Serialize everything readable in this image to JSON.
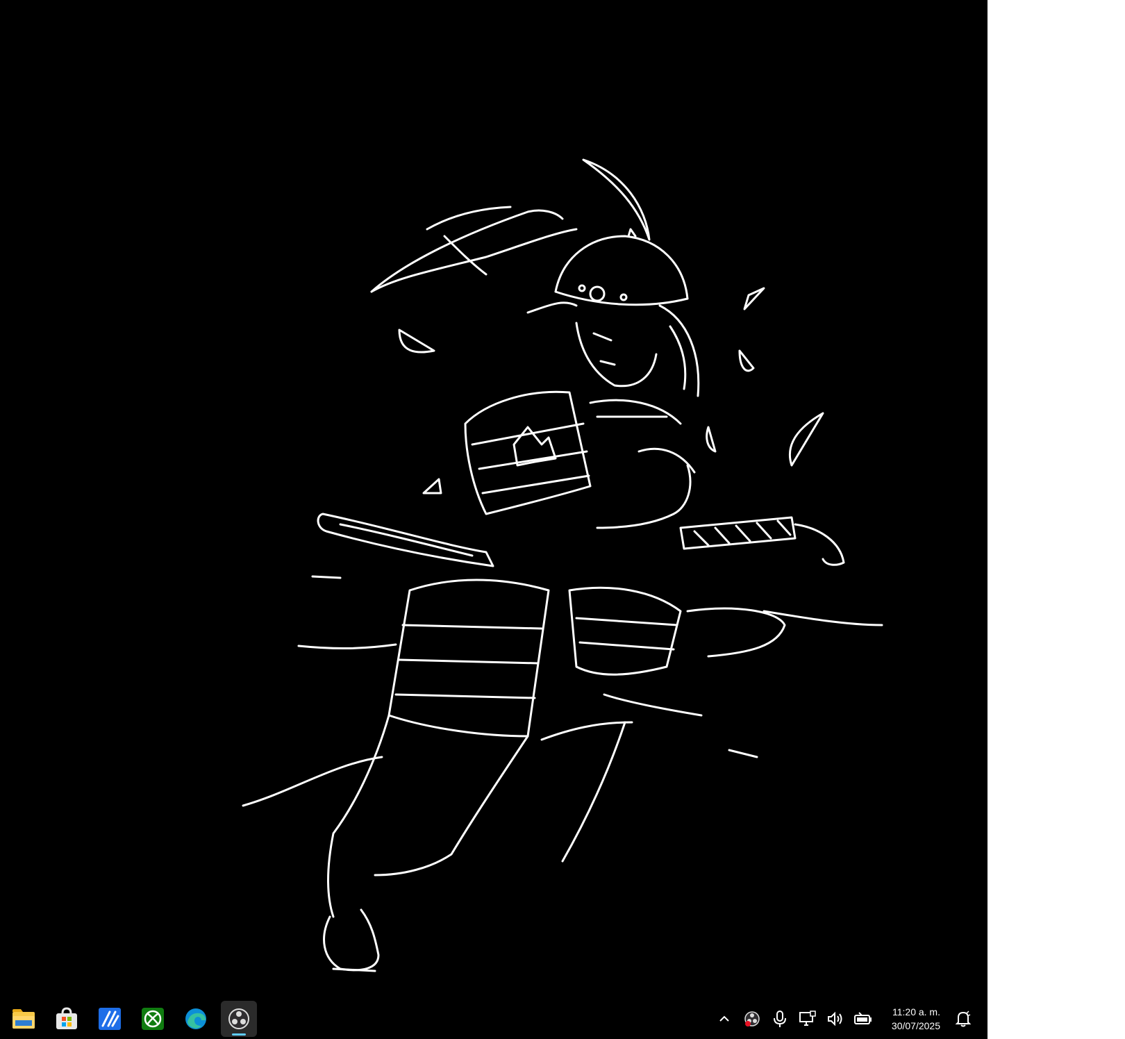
{
  "desktop": {
    "background_color": "#000000",
    "wallpaper_icon": "samurai-line-art-icon"
  },
  "taskbar": {
    "background_color": "#000000",
    "accent_color": "#60cdff",
    "pinned_apps": [
      {
        "name": "file-explorer-icon",
        "active": false
      },
      {
        "name": "microsoft-store-icon",
        "active": false
      },
      {
        "name": "app-blue-icon",
        "active": false
      },
      {
        "name": "xbox-icon",
        "active": false
      },
      {
        "name": "edge-icon",
        "active": false
      },
      {
        "name": "obs-icon",
        "active": true
      }
    ],
    "tray_icons": [
      "chevron-up-icon",
      "obs-tray-icon",
      "microphone-icon",
      "network-icon",
      "volume-icon",
      "battery-icon"
    ],
    "clock": {
      "time": "11:20 a. m.",
      "date": "30/07/2025"
    },
    "notification_icon": "notification-bell-icon"
  }
}
